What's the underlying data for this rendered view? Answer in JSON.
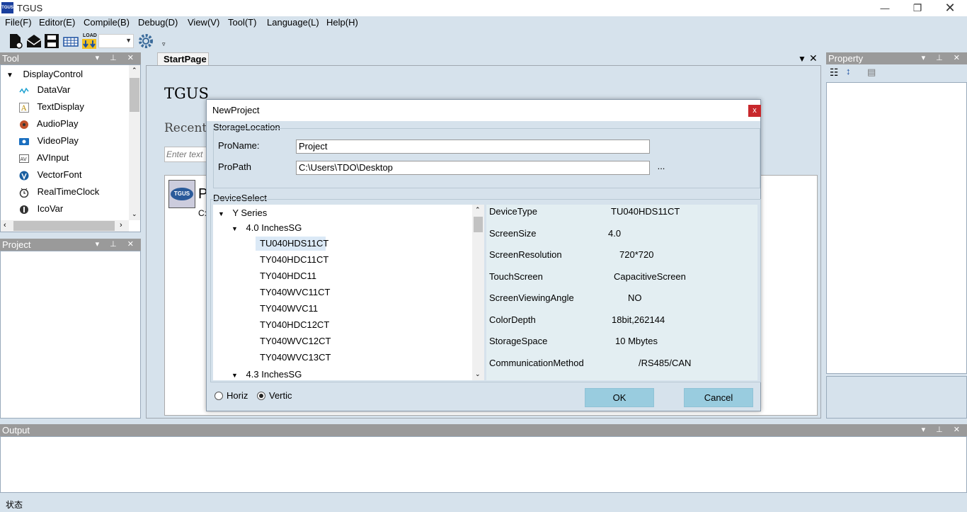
{
  "app": {
    "logo_text": "TGUS",
    "title": "TGUS"
  },
  "menu": [
    "File(F)",
    "Editor(E)",
    "Compile(B)",
    "Debug(D)",
    "View(V)",
    "Tool(T)",
    "Language(L)",
    "Help(H)"
  ],
  "toolbar": {
    "load_label": "LOAD",
    "combo_value": ""
  },
  "tool_panel": {
    "title": "Tool",
    "root": "DisplayControl",
    "items": [
      "DataVar",
      "TextDisplay",
      "AudioPlay",
      "VideoPlay",
      "AVInput",
      "VectorFont",
      "RealTimeClock",
      "IcoVar"
    ]
  },
  "project_panel": {
    "title": "Project"
  },
  "output_panel": {
    "title": "Output"
  },
  "property_panel": {
    "title": "Property"
  },
  "start_page": {
    "tab": "StartPage",
    "heading": "TGUS",
    "recent_label": "Recent",
    "search_placeholder": "Enter text",
    "recent_item_letter": "P",
    "recent_item_path": "C:"
  },
  "dialog": {
    "title": "NewProject",
    "close": "x",
    "storage_group": "StorageLocation",
    "proname_label": "ProName:",
    "proname_value": "Project",
    "propath_label": "ProPath",
    "propath_value": "C:\\Users\\TDO\\Desktop",
    "browse": "...",
    "device_group": "DeviceSelect",
    "tree": {
      "series": "Y Series",
      "group1": "4.0 InchesSG",
      "devices": [
        "TU040HDS11CT",
        "TY040HDC11CT",
        "TY040HDC11",
        "TY040WVC11CT",
        "TY040WVC11",
        "TY040HDC12CT",
        "TY040WVC12CT",
        "TY040WVC13CT"
      ],
      "group2": "4.3 InchesSG"
    },
    "props": [
      {
        "label": "DeviceType",
        "value": "TU040HDS11CT"
      },
      {
        "label": "ScreenSize",
        "value": "4.0"
      },
      {
        "label": "ScreenResolution",
        "value": "720*720"
      },
      {
        "label": "TouchScreen",
        "value": "CapacitiveScreen"
      },
      {
        "label": "ScreenViewingAngle",
        "value": "NO"
      },
      {
        "label": "ColorDepth",
        "value": "18bit,262144"
      },
      {
        "label": "StorageSpace",
        "value": "10 Mbytes"
      },
      {
        "label": "CommunicationMethod",
        "value": "/RS485/CAN"
      }
    ],
    "orientation": {
      "horiz": "Horiz",
      "vertic": "Vertic",
      "selected": "Vertic"
    },
    "ok": "OK",
    "cancel": "Cancel"
  },
  "status": "状态",
  "colors": {
    "accent_button": "#99ccdf",
    "selected_item": "#dbe9f6",
    "close_red": "#c8282c"
  }
}
